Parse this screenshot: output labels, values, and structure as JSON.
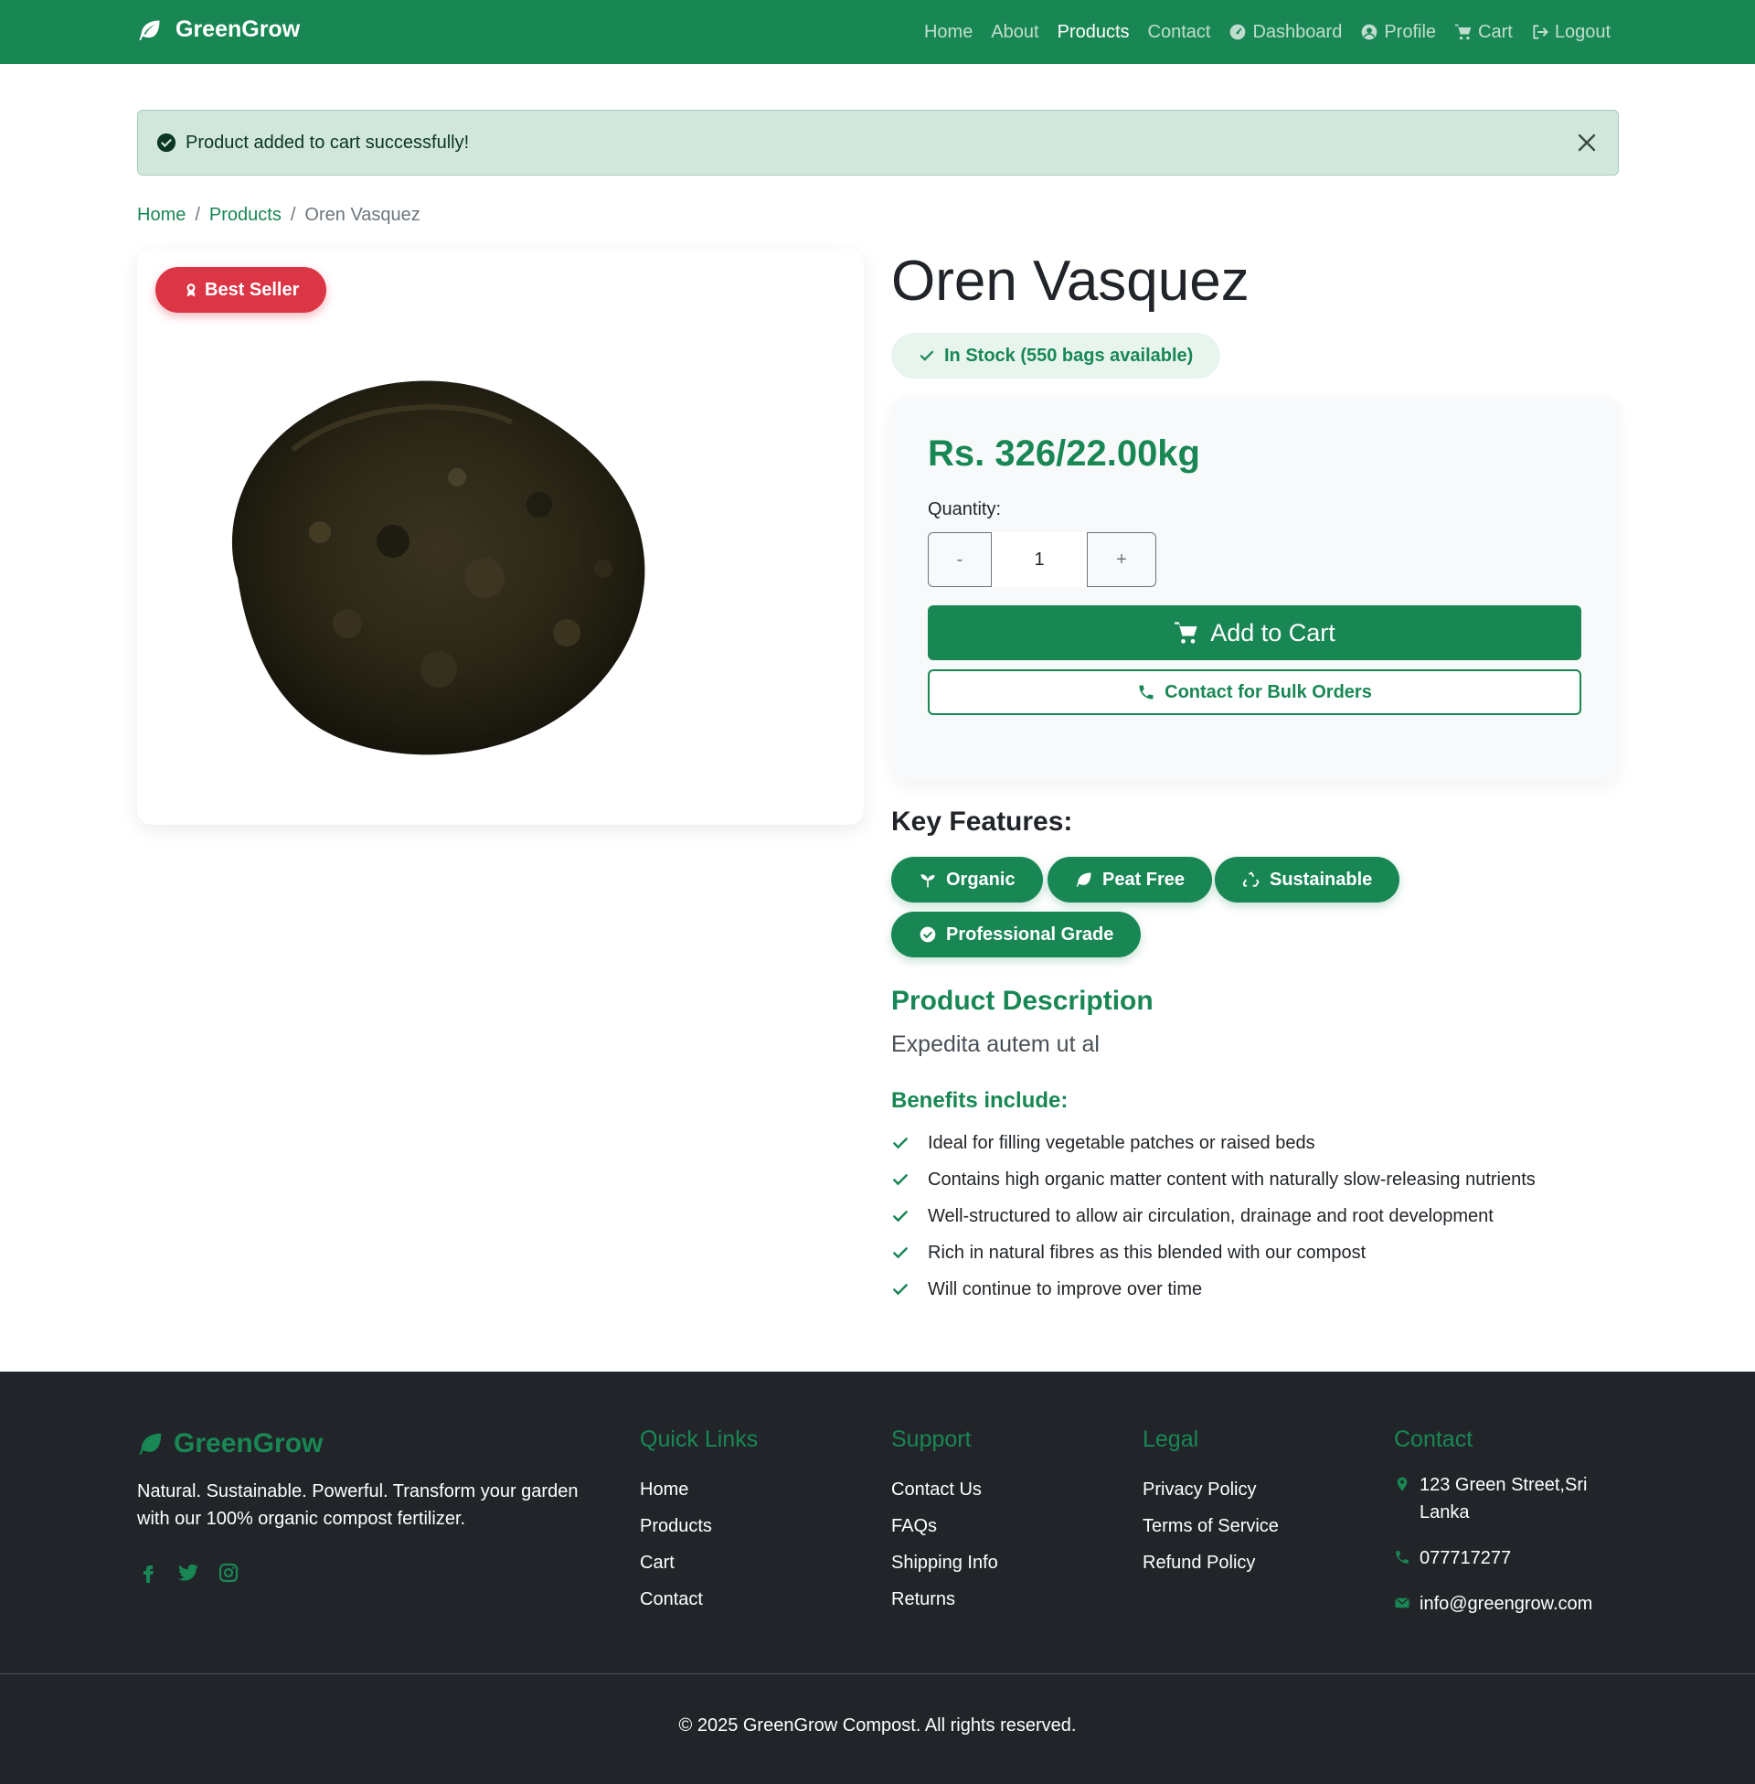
{
  "brand": {
    "name": "GreenGrow",
    "icon": "leaf-icon"
  },
  "nav": {
    "items": [
      {
        "label": "Home",
        "icon": ""
      },
      {
        "label": "About",
        "icon": ""
      },
      {
        "label": "Products",
        "icon": "",
        "active": true
      },
      {
        "label": "Contact",
        "icon": ""
      },
      {
        "label": "Dashboard",
        "icon": "gauge-icon"
      },
      {
        "label": "Profile",
        "icon": "user-circle-icon"
      },
      {
        "label": "Cart",
        "icon": "cart-icon"
      },
      {
        "label": "Logout",
        "icon": "logout-icon"
      }
    ]
  },
  "alert": {
    "message": "Product added to cart successfully!"
  },
  "breadcrumb": {
    "home": "Home",
    "products": "Products",
    "current": "Oren Vasquez",
    "separator": "/"
  },
  "product": {
    "badge": "Best Seller",
    "title": "Oren Vasquez",
    "stock": "In Stock (550 bags available)",
    "price": "Rs. 326/22.00kg",
    "quantity_label": "Quantity:",
    "quantity_value": "1",
    "minus": "-",
    "plus": "+",
    "add_to_cart": "Add to Cart",
    "bulk_orders": "Contact for Bulk Orders"
  },
  "features": {
    "title": "Key Features:",
    "items": [
      {
        "label": "Organic",
        "icon": "seedling-icon"
      },
      {
        "label": "Peat Free",
        "icon": "leaf-icon"
      },
      {
        "label": "Sustainable",
        "icon": "recycle-icon"
      },
      {
        "label": "Professional Grade",
        "icon": "check-circle-icon"
      }
    ]
  },
  "description": {
    "title": "Product Description",
    "text": "Expedita autem ut al",
    "benefits_title": "Benefits include:",
    "benefits": [
      "Ideal for filling vegetable patches or raised beds",
      "Contains high organic matter content with naturally slow-releasing nutrients",
      "Well-structured to allow air circulation, drainage and root development",
      "Rich in natural fibres as this blended with our compost",
      "Will continue to improve over time"
    ]
  },
  "footer": {
    "brand": "GreenGrow",
    "about": "Natural. Sustainable. Powerful. Transform your garden with our 100% organic compost fertilizer.",
    "quick_links": {
      "title": "Quick Links",
      "items": [
        "Home",
        "Products",
        "Cart",
        "Contact"
      ]
    },
    "support": {
      "title": "Support",
      "items": [
        "Contact Us",
        "FAQs",
        "Shipping Info",
        "Returns"
      ]
    },
    "legal": {
      "title": "Legal",
      "items": [
        "Privacy Policy",
        "Terms of Service",
        "Refund Policy"
      ]
    },
    "contact": {
      "title": "Contact",
      "address": "123 Green Street,Sri Lanka",
      "phone": "077717277",
      "email": "info@greengrow.com"
    },
    "copyright": "© 2025 GreenGrow Compost. All rights reserved."
  },
  "colors": {
    "primary": "#198754",
    "danger": "#dc3545",
    "footer_bg": "#212529",
    "alert_bg": "#d1e7dd"
  }
}
